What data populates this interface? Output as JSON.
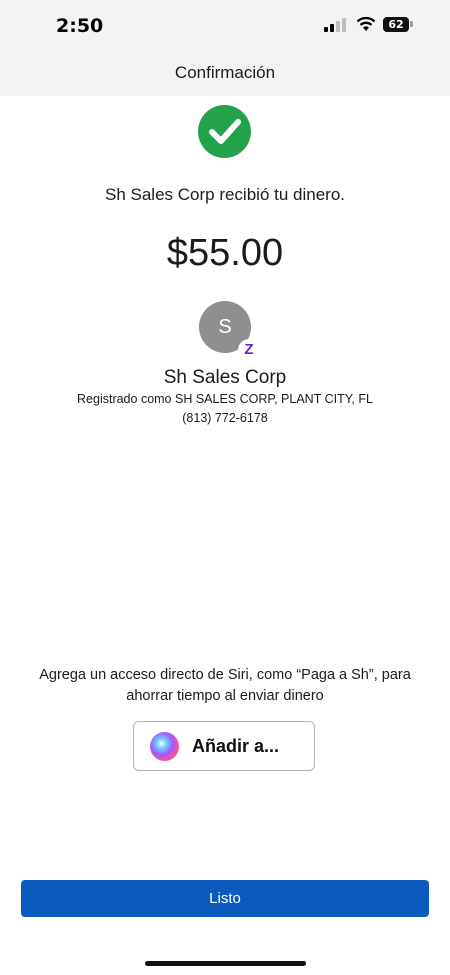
{
  "status_bar": {
    "time": "2:50",
    "battery": "62",
    "icons": [
      "cellular-signal-icon",
      "wifi-icon",
      "battery-icon"
    ]
  },
  "header": {
    "title": "Confirmación"
  },
  "confirmation": {
    "icon": "checkmark-circle-icon",
    "message": "Sh Sales Corp recibió tu dinero.",
    "amount": "$55.00"
  },
  "recipient": {
    "avatar_initial": "S",
    "badge_icon": "zelle-icon",
    "badge_glyph": "Z",
    "name": "Sh Sales Corp",
    "registered_as": "Registrado como SH SALES CORP, PLANT CITY, FL",
    "phone": "(813) 772-6178"
  },
  "siri": {
    "prompt": "Agrega un acceso directo de Siri, como “Paga a Sh”, para ahorrar tiempo al enviar dinero",
    "button_label": "Añadir a...",
    "icon": "siri-icon"
  },
  "footer": {
    "done_label": "Listo"
  },
  "colors": {
    "accent_blue": "#0a5bbd",
    "success_green": "#23a24a",
    "zelle_purple": "#6d1ed4",
    "header_bg": "#f3f3f5"
  }
}
